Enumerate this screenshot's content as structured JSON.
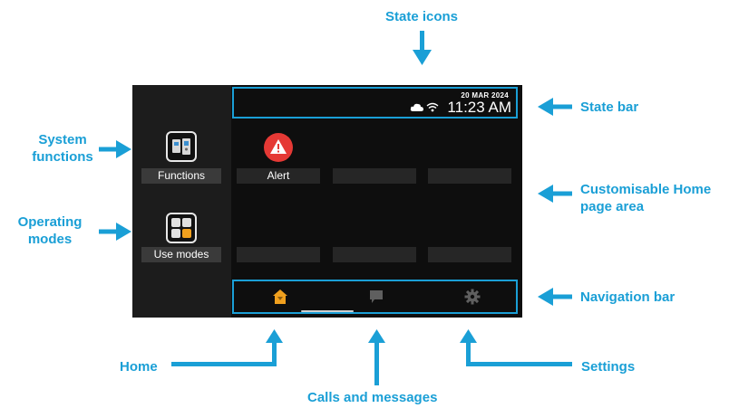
{
  "callouts": {
    "state_icons": "State icons",
    "state_bar": "State bar",
    "system_functions": [
      "System",
      "functions"
    ],
    "operating_modes": [
      "Operating",
      "modes"
    ],
    "customisable_home": [
      "Customisable Home",
      "page area"
    ],
    "navigation_bar": "Navigation bar",
    "home": "Home",
    "settings": "Settings",
    "calls_messages": "Calls and messages"
  },
  "device": {
    "date": "20 MAR 2024",
    "time": "11:23 AM",
    "functions_label": "Functions",
    "use_modes_label": "Use modes",
    "alert_label": "Alert"
  },
  "colors": {
    "accent": "#1a9fd6",
    "alert_red": "#e53935",
    "home_orange": "#f0a01e",
    "screen_bg": "#0e0e0e"
  }
}
